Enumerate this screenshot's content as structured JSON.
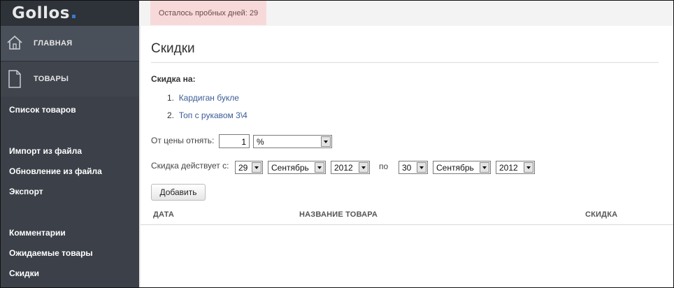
{
  "app": {
    "logo": "Gollos"
  },
  "sidebar": {
    "main_label": "ГЛАВНАЯ",
    "products_label": "ТОВАРЫ",
    "items": [
      {
        "label": "Список товаров"
      },
      {
        "label": "Импорт из файла"
      },
      {
        "label": "Обновление из файла"
      },
      {
        "label": "Экспорт"
      },
      {
        "label": "Комментарии"
      },
      {
        "label": "Ожидаемые товары"
      },
      {
        "label": "Скидки"
      }
    ]
  },
  "topbar": {
    "trial_text": "Осталось пробных дней: 29"
  },
  "page": {
    "title": "Скидки",
    "discount_for_label": "Скидка на:",
    "products": [
      {
        "num": "1.",
        "name": "Кардиган букле"
      },
      {
        "num": "2.",
        "name": "Топ с рукавом 3\\4"
      }
    ],
    "price_label": "От цены отнять:",
    "price_value": "1",
    "unit_select": "%",
    "valid_label": "Скидка действует с:",
    "from": {
      "day": "29",
      "month": "Сентябрь",
      "year": "2012"
    },
    "to_label": "по",
    "to": {
      "day": "30",
      "month": "Сентябрь",
      "year": "2012"
    },
    "add_button": "Добавить",
    "table": {
      "columns": [
        "ДАТА",
        "НАЗВАНИЕ ТОВАРА",
        "СКИДКА"
      ]
    }
  }
}
